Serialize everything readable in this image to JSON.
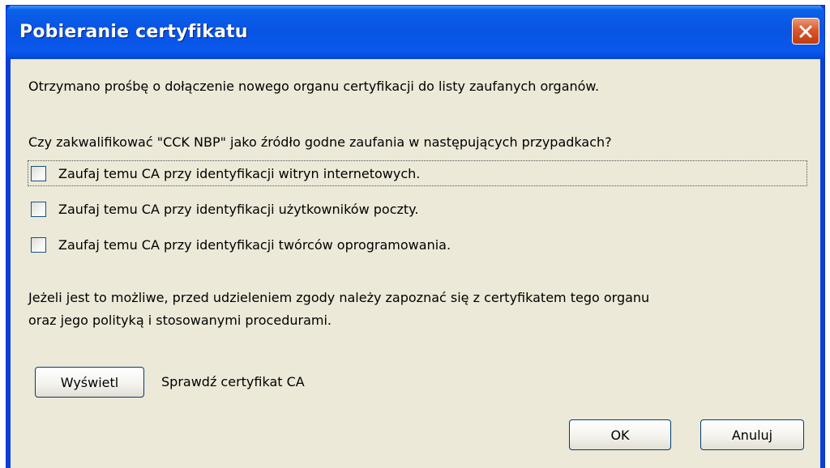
{
  "window": {
    "title": "Pobieranie certyfikatu"
  },
  "icons": {
    "close": "close-icon"
  },
  "colors": {
    "titlebar": "#0a59ec",
    "client_background": "#ece9d8",
    "close_button": "#d9582e"
  },
  "dialog": {
    "intro": "Otrzymano prośbę o dołączenie nowego organu certyfikacji do listy zaufanych organów.",
    "question": "Czy zakwalifikować \"CCK NBP\" jako źródło godne zaufania w następujących przypadkach?",
    "checkboxes": [
      {
        "label": "Zaufaj temu CA przy identyfikacji witryn internetowych.",
        "checked": false
      },
      {
        "label": "Zaufaj temu CA przy identyfikacji użytkowników poczty.",
        "checked": false
      },
      {
        "label": "Zaufaj temu CA przy identyfikacji twórców oprogramowania.",
        "checked": false
      }
    ],
    "advice_line1": "Jeżeli jest to możliwe, przed udzieleniem zgody należy zapoznać się z certyfikatem tego organu",
    "advice_line2": "oraz jego polityką i stosowanymi procedurami.",
    "view_button": "Wyświetl",
    "view_label": "Sprawdź certyfikat CA",
    "ok_button": "OK",
    "cancel_button": "Anuluj"
  }
}
